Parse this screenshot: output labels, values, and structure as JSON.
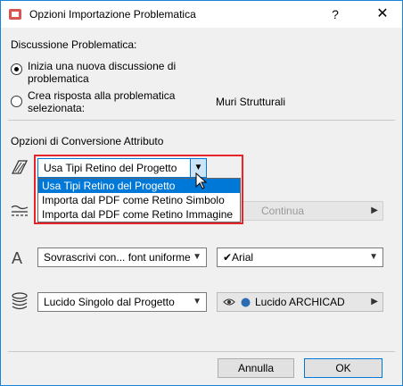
{
  "window": {
    "title": "Opzioni Importazione Problematica",
    "help_label": "?",
    "close_label": "✕"
  },
  "discussion": {
    "heading": "Discussione Problematica:",
    "option_new": "Inizia una nuova discussione di problematica",
    "option_new_line1": "Inizia una nuova discussione di",
    "option_new_line2": "problematica",
    "option_reply_line1": "Crea risposta alla problematica",
    "option_reply_line2": "selezionata:",
    "selected_issue": "Muri Strutturali",
    "selected_option": "new"
  },
  "conversion": {
    "heading": "Opzioni di Conversione Attributo",
    "fill": {
      "selected": "Usa Tipi Retino del Progetto",
      "options": [
        "Usa Tipi Retino del Progetto",
        "Importa dal PDF come Retino Simbolo",
        "Importa dal PDF come Retino Immagine"
      ],
      "highlighted_index": 0
    },
    "line": {
      "disabled_value": "Continua"
    },
    "font": {
      "selected": "Sovrascrivi con... font uniforme",
      "font_value": "✔Arial"
    },
    "layer": {
      "selected": "Lucido Singolo dal Progetto",
      "layer_value": "Lucido ARCHICAD"
    }
  },
  "buttons": {
    "cancel": "Annulla",
    "ok": "OK"
  },
  "icons": {
    "fill": "hatch-fill-icon",
    "line": "line-type-icon",
    "font": "font-letter-icon",
    "layer": "layers-stack-icon",
    "eye": "eye-icon",
    "layer_small": "layer-badge-icon"
  }
}
